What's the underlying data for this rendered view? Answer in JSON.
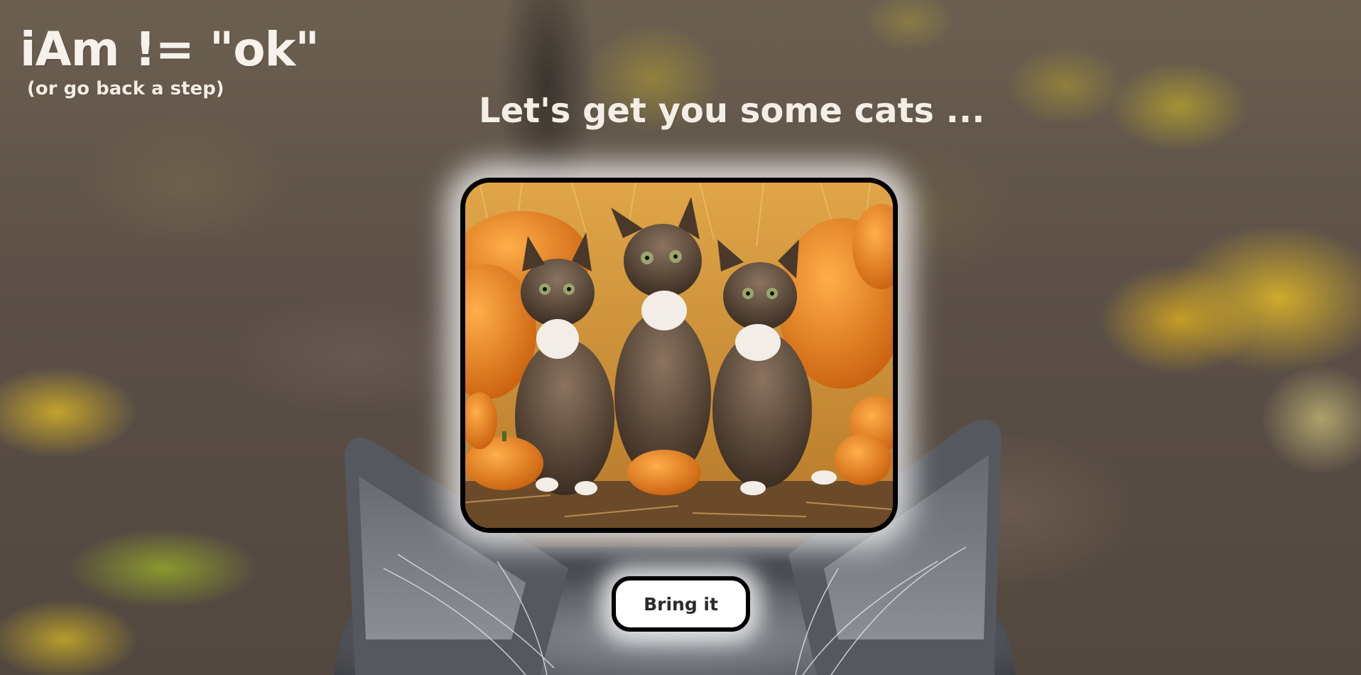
{
  "header": {
    "logo": "iAm != \"ok\"",
    "back_link": "(or go back a step)"
  },
  "main": {
    "headline": "Let's get you some cats ...",
    "photo": {
      "subject": "three tabby kittens sitting among pumpkins and straw"
    },
    "button_label": "Bring it"
  },
  "colors": {
    "text": "#f4eee6",
    "frame_border": "#000000",
    "button_bg": "#ffffff",
    "pumpkin": "#e8821e"
  }
}
